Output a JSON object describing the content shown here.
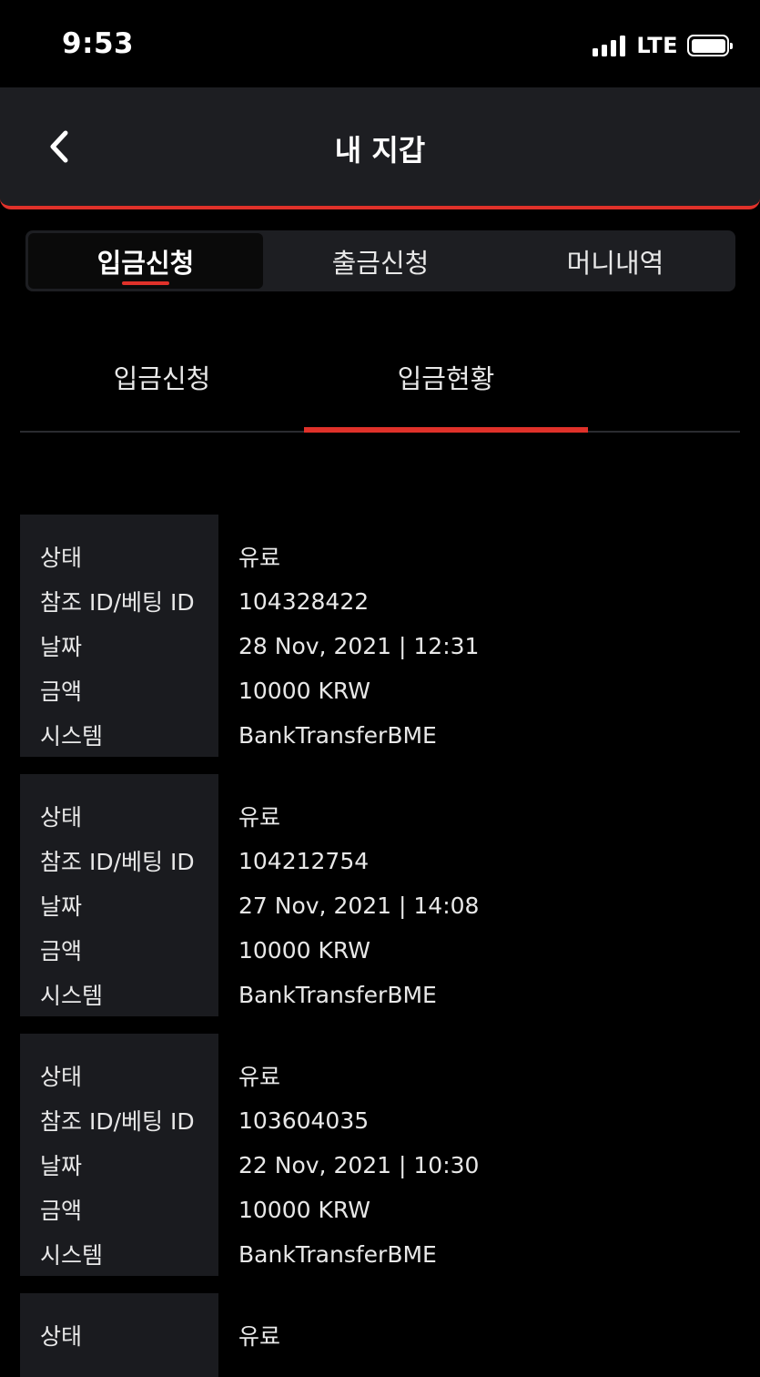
{
  "status_bar": {
    "time": "9:53",
    "network": "LTE"
  },
  "header": {
    "title": "내 지갑"
  },
  "main_tabs": [
    {
      "label": "입금신청"
    },
    {
      "label": "출금신청"
    },
    {
      "label": "머니내역"
    }
  ],
  "sub_tabs": [
    {
      "label": "입금신청"
    },
    {
      "label": "입금현황"
    }
  ],
  "field_labels": {
    "status": "상태",
    "ref_id": "참조 ID/베팅 ID",
    "date": "날짜",
    "amount": "금액",
    "system": "시스템"
  },
  "records": [
    {
      "status": "유료",
      "ref_id": "104328422",
      "date": "28 Nov, 2021 | 12:31",
      "amount": "10000 KRW",
      "system": "BankTransferBME"
    },
    {
      "status": "유료",
      "ref_id": "104212754",
      "date": "27 Nov, 2021 | 14:08",
      "amount": "10000 KRW",
      "system": "BankTransferBME"
    },
    {
      "status": "유료",
      "ref_id": "103604035",
      "date": "22 Nov, 2021 | 10:30",
      "amount": "10000 KRW",
      "system": "BankTransferBME"
    },
    {
      "status": "유료"
    }
  ],
  "colors": {
    "accent": "#e0312a",
    "panel": "#1d1e22",
    "background": "#000000"
  }
}
